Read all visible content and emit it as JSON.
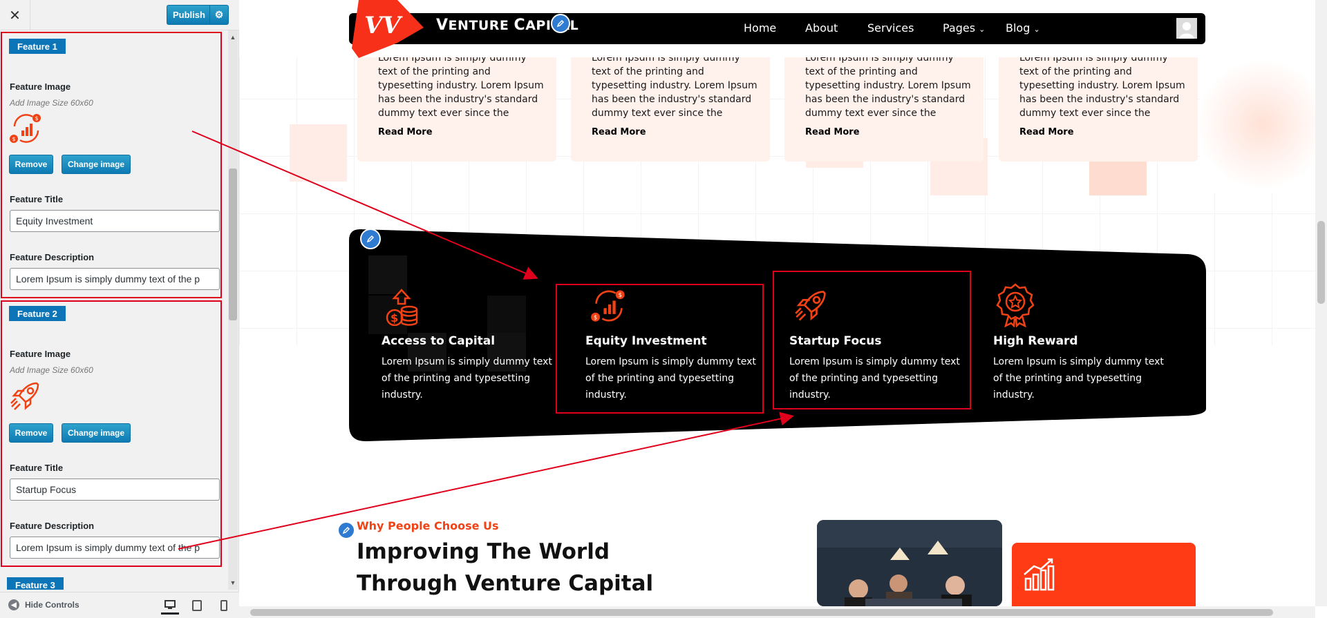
{
  "panel": {
    "close_icon": "close-icon",
    "publish_label": "Publish",
    "publish_settings_icon": "gear-icon",
    "feature1": {
      "tag": "Feature 1",
      "image_label": "Feature Image",
      "image_note": "Add Image Size 60x60",
      "image_icon": "growth-chart-icon",
      "remove_label": "Remove",
      "change_label": "Change image",
      "title_label": "Feature Title",
      "title_value": "Equity Investment",
      "desc_label": "Feature Description",
      "desc_value": "Lorem Ipsum is simply dummy text of the p"
    },
    "feature2": {
      "tag": "Feature 2",
      "image_label": "Feature Image",
      "image_note": "Add Image Size 60x60",
      "image_icon": "rocket-icon",
      "remove_label": "Remove",
      "change_label": "Change image",
      "title_label": "Feature Title",
      "title_value": "Startup Focus",
      "desc_label": "Feature Description",
      "desc_value": "Lorem Ipsum is simply dummy text of the p"
    },
    "feature3_tag": "Feature 3",
    "footer": {
      "hide_controls_label": "Hide Controls",
      "devices": [
        "desktop-icon",
        "tablet-icon",
        "mobile-icon"
      ]
    }
  },
  "preview": {
    "brand_first": "V",
    "brand_rest": "ENTURE ",
    "brand_c": "C",
    "brand_rest2": "APITAL",
    "nav": [
      "Home",
      "About",
      "Services",
      "Pages",
      "Blog"
    ],
    "cards": [
      {
        "text": "Lorem Ipsum is simply dummy text of the printing and typesetting industry. Lorem Ipsum has been the industry's standard dummy text ever since the",
        "link": "Read More"
      },
      {
        "text": "Lorem Ipsum is simply dummy text of the printing and typesetting industry. Lorem Ipsum has been the industry's standard dummy text ever since the",
        "link": "Read More"
      },
      {
        "text": "Lorem Ipsum is simply dummy text of the printing and typesetting industry. Lorem Ipsum has been the industry's standard dummy text ever since the",
        "link": "Read More"
      },
      {
        "text": "Lorem Ipsum is simply dummy text of the printing and typesetting industry. Lorem Ipsum has been the industry's standard dummy text ever since the",
        "link": "Read More"
      }
    ],
    "features": [
      {
        "title": "Access to Capital",
        "desc": "Lorem Ipsum is simply dummy text of the printing and typesetting industry.",
        "icon": "coins-icon"
      },
      {
        "title": "Equity Investment",
        "desc": "Lorem Ipsum is simply dummy text of the printing and typesetting industry.",
        "icon": "growth-chart-icon"
      },
      {
        "title": "Startup Focus",
        "desc": "Lorem Ipsum is simply dummy text of the printing and typesetting industry.",
        "icon": "rocket-icon"
      },
      {
        "title": "High Reward",
        "desc": "Lorem Ipsum is simply dummy text of the printing and typesetting industry.",
        "icon": "award-badge-icon"
      }
    ],
    "why_label": "Why People Choose Us",
    "headline": "Improving The World Through Venture Capital",
    "accent": "#f04214",
    "annotation_color": "#e0001b"
  }
}
